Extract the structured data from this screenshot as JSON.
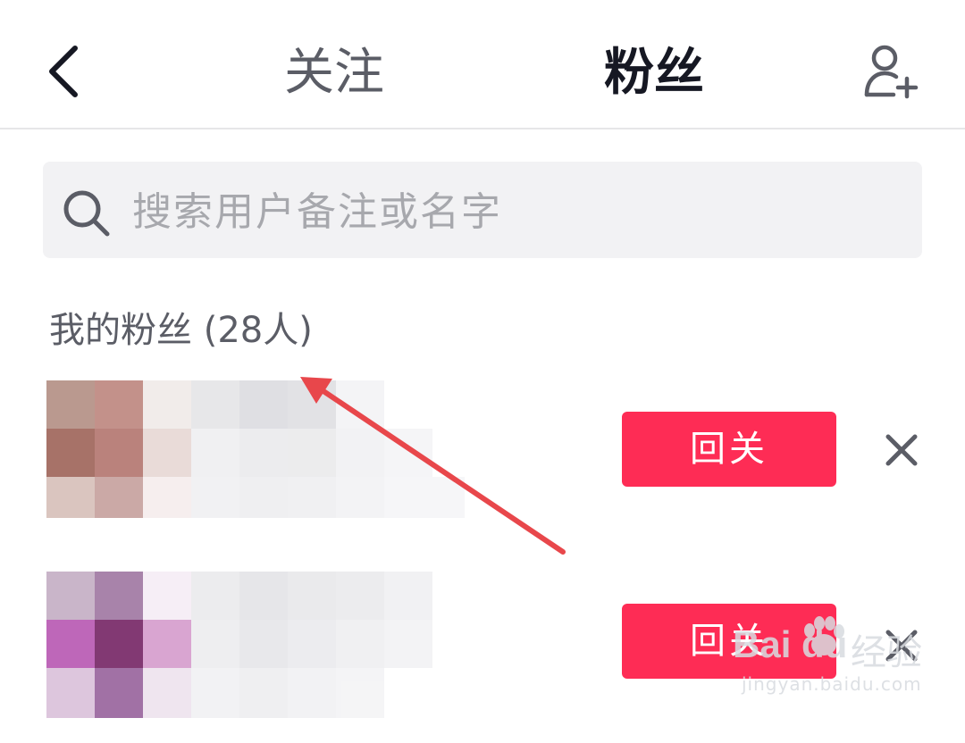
{
  "header": {
    "tabs": [
      {
        "label": "关注",
        "active": false
      },
      {
        "label": "粉丝",
        "active": true
      }
    ],
    "back_icon": "chevron-left-icon",
    "add_friend_icon": "add-user-icon"
  },
  "search": {
    "placeholder": "搜索用户备注或名字",
    "icon": "search-icon"
  },
  "section": {
    "title": "我的粉丝 (28人)"
  },
  "fans": [
    {
      "action_label": "回关",
      "remove_icon": "close-icon"
    },
    {
      "action_label": "回关",
      "remove_icon": "close-icon"
    }
  ],
  "colors": {
    "accent": "#fe2c55",
    "annotation_arrow": "#e8474b"
  },
  "watermark": {
    "brand": "Bai du",
    "label": "经验",
    "url": "jingyan.baidu.com"
  }
}
